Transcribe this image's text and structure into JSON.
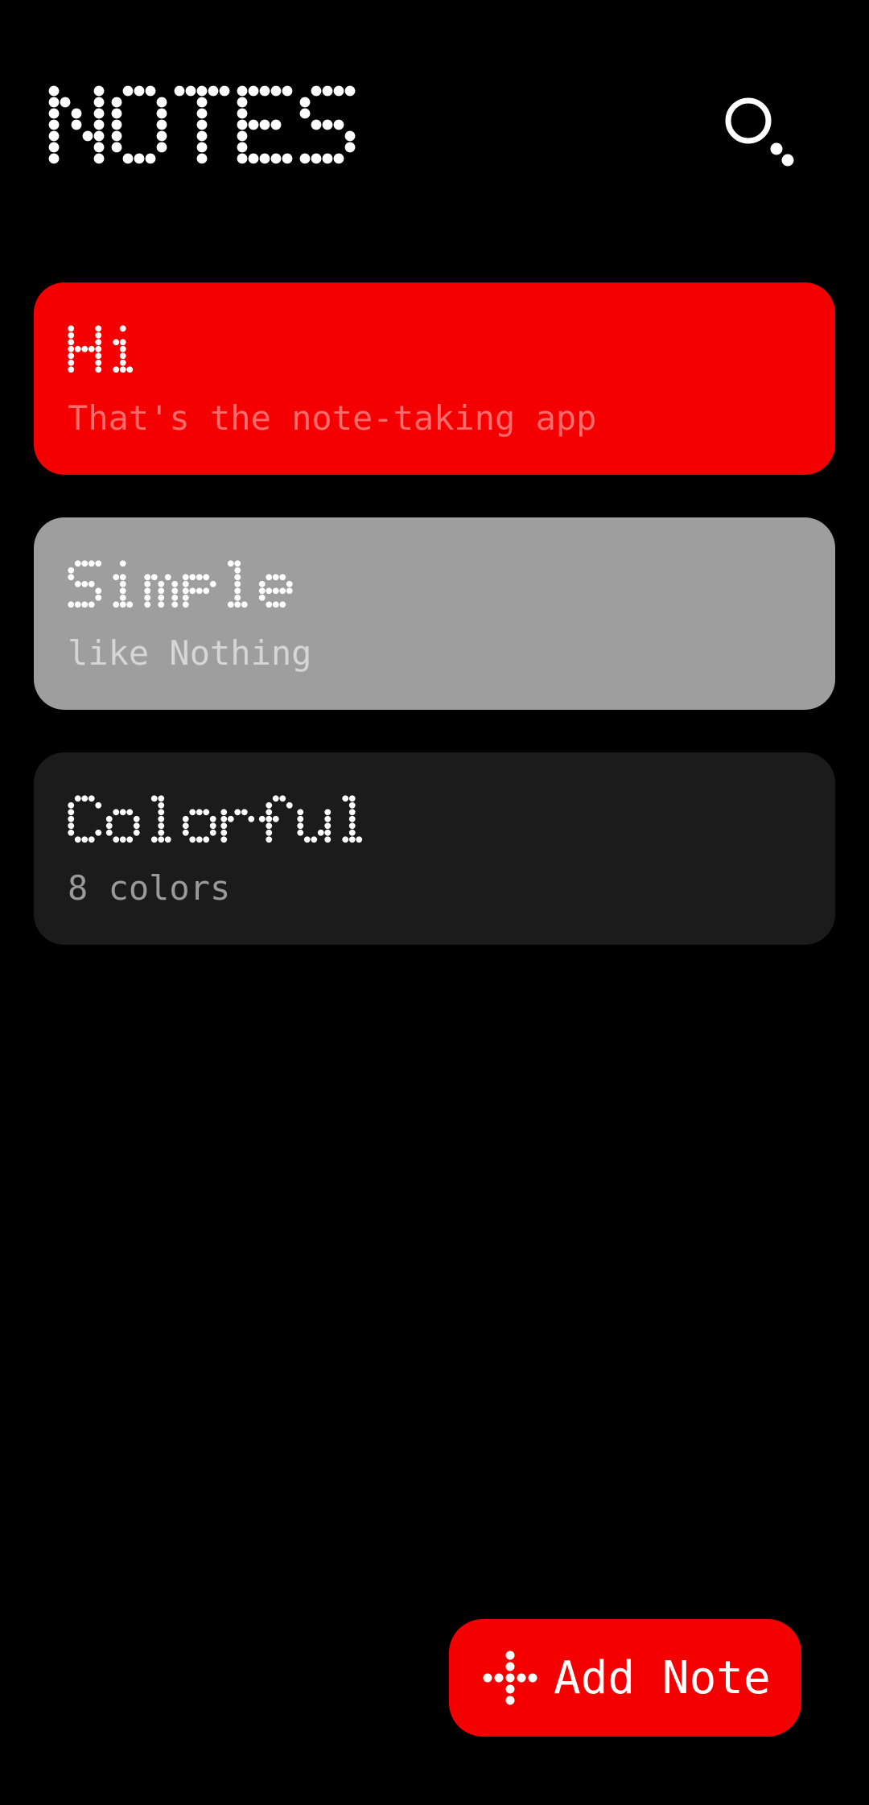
{
  "header": {
    "title": "NOTES",
    "search_icon": "search-icon"
  },
  "notes": [
    {
      "title": "Hi",
      "body": "That's the note-taking app",
      "color": "#f50000",
      "body_color": "#ff6b6b"
    },
    {
      "title": "Simple",
      "body": "like Nothing",
      "color": "#9e9e9e",
      "body_color": "#d6d6d6"
    },
    {
      "title": "Colorful",
      "body": "8 colors",
      "color": "#1b1b1b",
      "body_color": "#9a9a9a"
    }
  ],
  "fab": {
    "label": "Add Note",
    "icon": "plus-icon",
    "color": "#f50000"
  }
}
